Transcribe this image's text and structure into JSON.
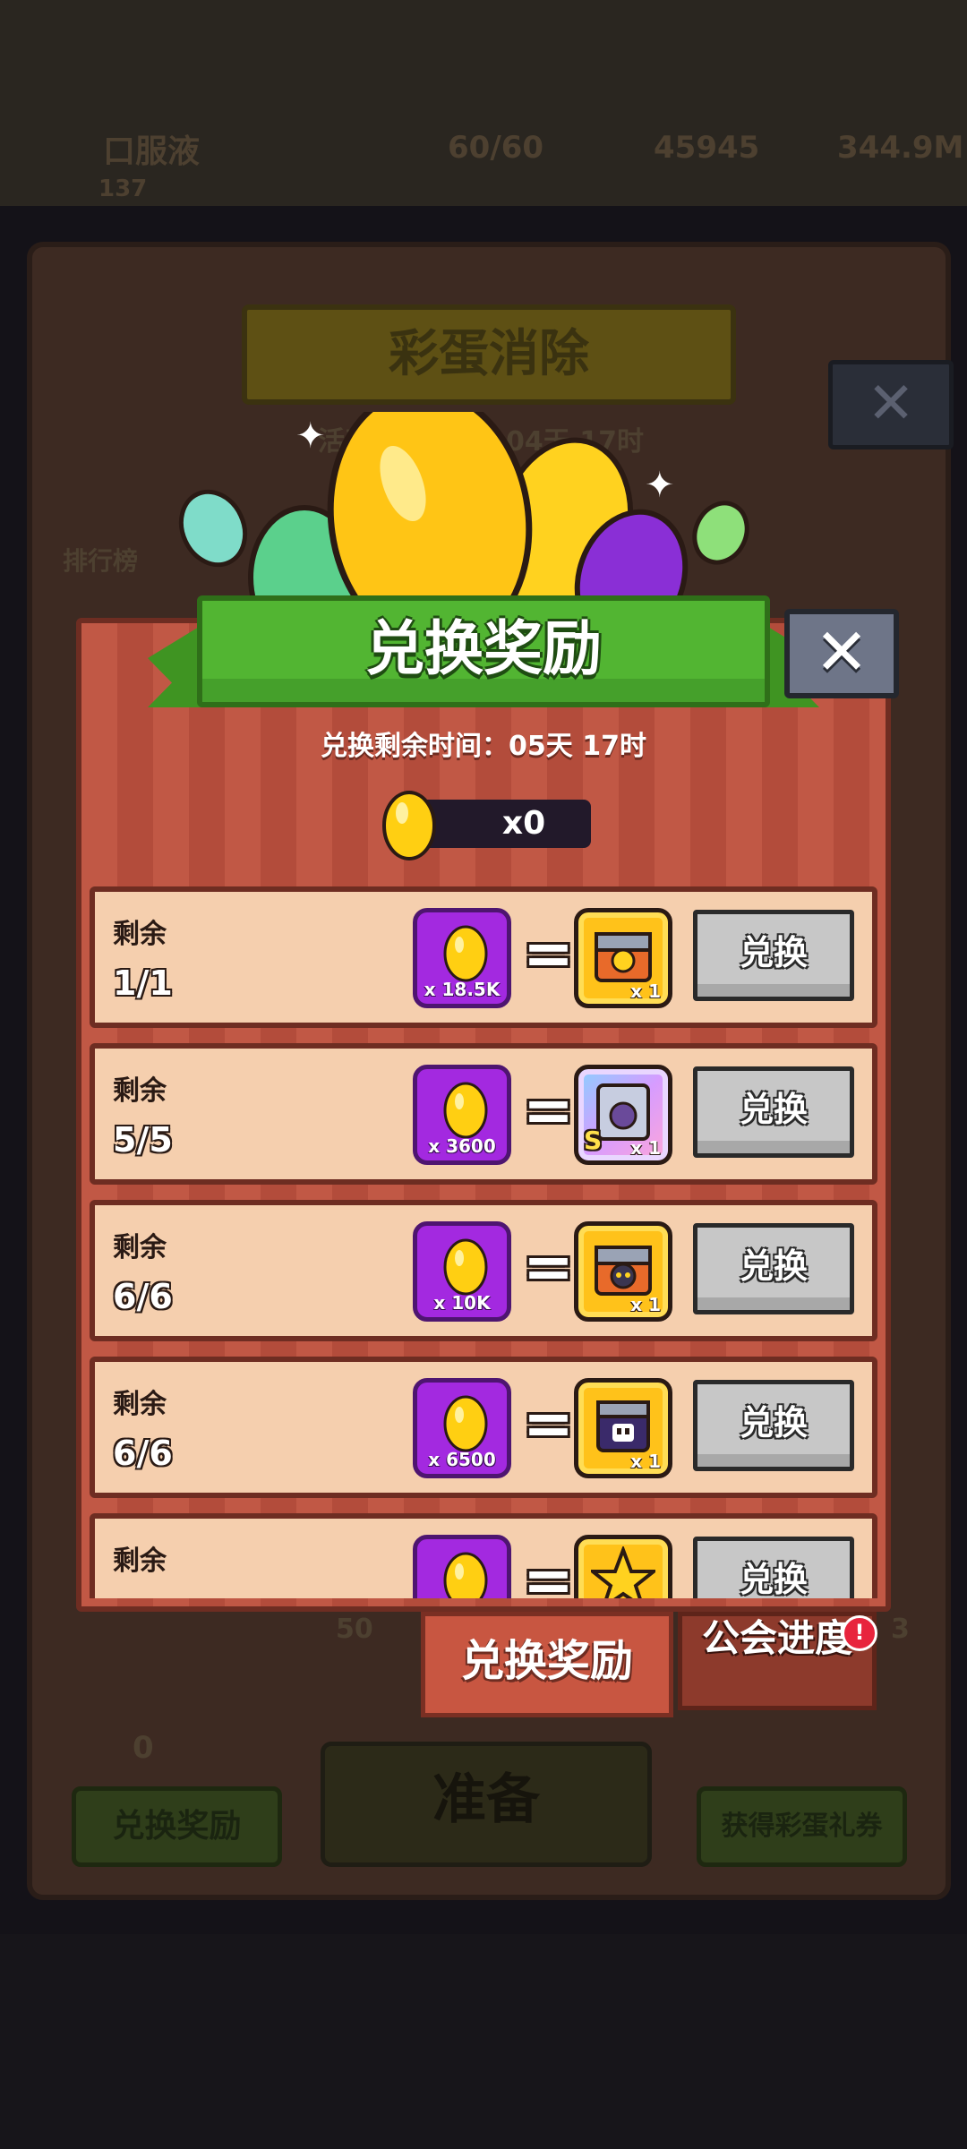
{
  "background": {
    "player_name": "口服液",
    "player_level": "137",
    "energy": "60/60",
    "gems": "45945",
    "coins": "344.9M",
    "event_title": "彩蛋消除",
    "event_time": "活动剩余时间：04天 17时",
    "leaderboard": "排行榜",
    "egg_count": "0",
    "redeem_button": "兑换奖励",
    "ready_button": "准备",
    "get_ticket_button": "获得彩蛋礼券",
    "side_value_left": "50",
    "side_value_right": "3"
  },
  "popup": {
    "title": "兑换奖励",
    "timer": "兑换剩余时间：05天 17时",
    "egg_count": "x0",
    "rows": [
      {
        "label": "剩余",
        "count": "1/1",
        "cost": "x 18.5K",
        "reward_qty": "x 1",
        "button": "兑换"
      },
      {
        "label": "剩余",
        "count": "5/5",
        "cost": "x 3600",
        "reward_qty": "x 1",
        "reward_badge": "S",
        "button": "兑换"
      },
      {
        "label": "剩余",
        "count": "6/6",
        "cost": "x 10K",
        "reward_qty": "x 1",
        "button": "兑换"
      },
      {
        "label": "剩余",
        "count": "6/6",
        "cost": "x 6500",
        "reward_qty": "x 1",
        "button": "兑换"
      },
      {
        "label": "剩余",
        "count": "",
        "cost": "",
        "reward_qty": "",
        "button": "兑换"
      }
    ]
  },
  "tabs": {
    "active": "兑换奖励",
    "inactive": "公会进度",
    "alert": "!"
  },
  "close_glyph": "✕"
}
